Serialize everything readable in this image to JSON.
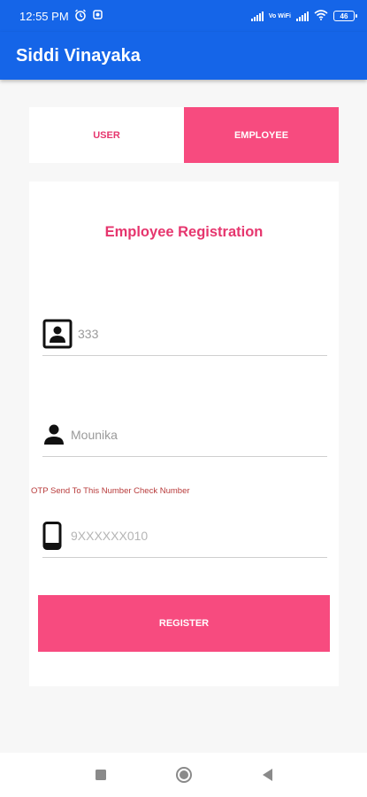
{
  "status_bar": {
    "time": "12:55 PM",
    "network_label": "Vo WiFi",
    "battery": "46",
    "icons": [
      "alarm-icon",
      "settings-sync-icon",
      "signal-icon",
      "volte-wifi-icon",
      "wifi-icon",
      "battery-icon"
    ]
  },
  "app_bar": {
    "title": "Siddi Vinayaka"
  },
  "tabs": [
    {
      "label": "USER",
      "selected": false
    },
    {
      "label": "EMPLOYEE",
      "selected": true
    }
  ],
  "form": {
    "title": "Employee Registration",
    "fields": [
      {
        "icon": "id-card-icon",
        "value": "333"
      },
      {
        "icon": "person-icon",
        "value": "Mounika"
      },
      {
        "icon": "phone-icon",
        "value": "",
        "placeholder": "9XXXXXX010"
      }
    ],
    "otp_note": "OTP Send To This Number Check Number",
    "register_label": "REGISTER"
  },
  "colors": {
    "primary": "#1565e8",
    "accent": "#f74b7f",
    "accent_text": "#e6366e"
  },
  "nav": {
    "icons": [
      "recents-icon",
      "home-icon",
      "back-icon"
    ]
  }
}
